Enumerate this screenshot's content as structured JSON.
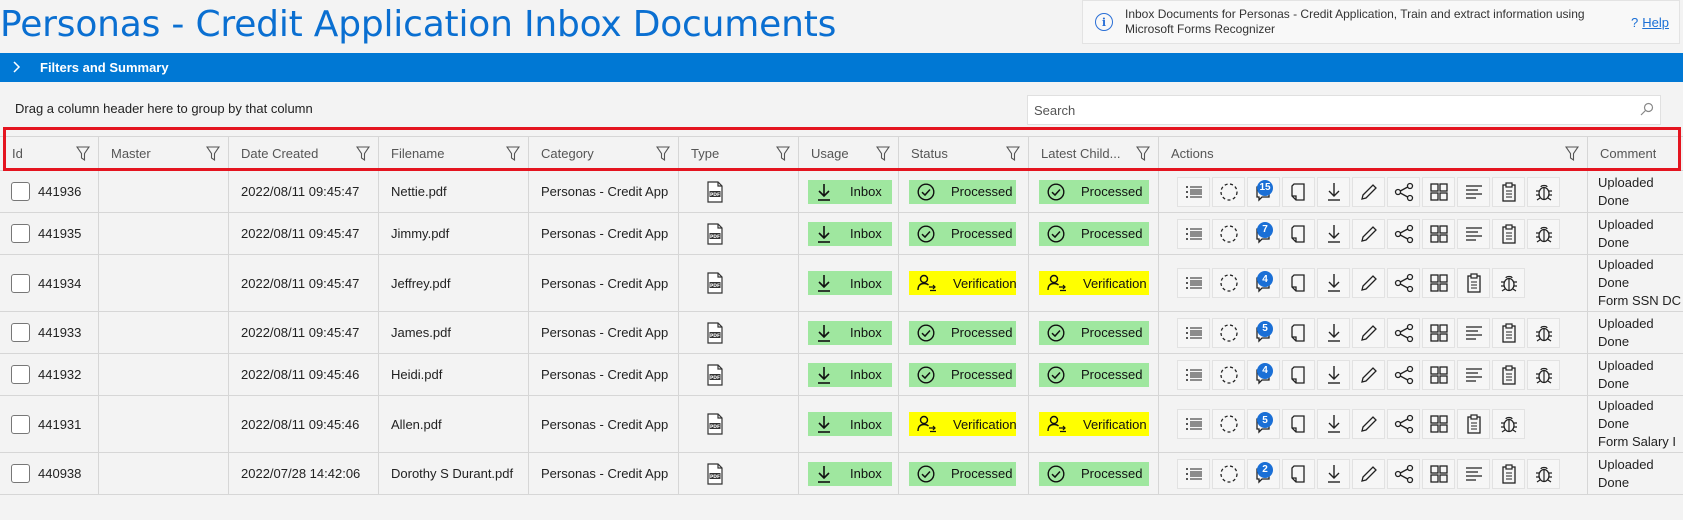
{
  "page": {
    "title": "Personas - Credit Application Inbox Documents",
    "info_text": "Inbox Documents for Personas - Credit Application, Train and extract information using Microsoft Forms Recognizer",
    "help_icon": "?",
    "help_label": "Help",
    "filters_label": "Filters and Summary",
    "group_hint": "Drag a column header here to group by that column",
    "search_placeholder": "Search"
  },
  "columns": [
    {
      "label": "Id"
    },
    {
      "label": "Master"
    },
    {
      "label": "Date Created"
    },
    {
      "label": "Filename"
    },
    {
      "label": "Category"
    },
    {
      "label": "Type"
    },
    {
      "label": "Usage"
    },
    {
      "label": "Status"
    },
    {
      "label": "Latest Child..."
    },
    {
      "label": "Actions"
    },
    {
      "label": "Comment"
    }
  ],
  "rows": [
    {
      "id": "441936",
      "master": "",
      "date": "2022/08/11 09:45:47",
      "filename": "Nettie.pdf",
      "category": "Personas - Credit App",
      "usage": "Inbox",
      "status": "Processed",
      "child": "Processed",
      "badge": "15",
      "comment": [
        "Uploaded",
        "Done"
      ]
    },
    {
      "id": "441935",
      "master": "",
      "date": "2022/08/11 09:45:47",
      "filename": "Jimmy.pdf",
      "category": "Personas - Credit App",
      "usage": "Inbox",
      "status": "Processed",
      "child": "Processed",
      "badge": "7",
      "comment": [
        "Uploaded",
        "Done"
      ]
    },
    {
      "id": "441934",
      "master": "",
      "date": "2022/08/11 09:45:47",
      "filename": "Jeffrey.pdf",
      "category": "Personas - Credit App",
      "usage": "Inbox",
      "status": "Verification",
      "child": "Verification",
      "badge": "4",
      "comment": [
        "Uploaded",
        "Done",
        "Form SSN DC"
      ]
    },
    {
      "id": "441933",
      "master": "",
      "date": "2022/08/11 09:45:47",
      "filename": "James.pdf",
      "category": "Personas - Credit App",
      "usage": "Inbox",
      "status": "Processed",
      "child": "Processed",
      "badge": "5",
      "comment": [
        "Uploaded",
        "Done"
      ]
    },
    {
      "id": "441932",
      "master": "",
      "date": "2022/08/11 09:45:46",
      "filename": "Heidi.pdf",
      "category": "Personas - Credit App",
      "usage": "Inbox",
      "status": "Processed",
      "child": "Processed",
      "badge": "4",
      "comment": [
        "Uploaded",
        "Done"
      ]
    },
    {
      "id": "441931",
      "master": "",
      "date": "2022/08/11 09:45:46",
      "filename": "Allen.pdf",
      "category": "Personas - Credit App",
      "usage": "Inbox",
      "status": "Verification",
      "child": "Verification",
      "badge": "5",
      "comment": [
        "Uploaded",
        "Done",
        "Form Salary I"
      ]
    },
    {
      "id": "440938",
      "master": "",
      "date": "2022/07/28 14:42:06",
      "filename": "Dorothy S Durant.pdf",
      "category": "Personas - Credit App",
      "usage": "Inbox",
      "status": "Processed",
      "child": "Processed",
      "badge": "2",
      "comment": [
        "Uploaded",
        "Done"
      ]
    }
  ],
  "colors": {
    "accent": "#0078d4",
    "title": "#0a6fd1",
    "processed": "#9fe79f",
    "verification": "#ffff00",
    "highlight": "#e4141f",
    "badge": "#1a6fd6"
  },
  "icons": {
    "info": "info-icon",
    "filters_chevron": "chevron-right-icon",
    "search": "search-icon",
    "column_filter": "funnel-icon",
    "type": "pdf-file-icon",
    "usage": "download-arrow-icon",
    "processed": "check-circle-icon",
    "verification": "user-transfer-icon",
    "actions": [
      "list-icon",
      "dashed-circle-icon",
      "comments-icon",
      "document-corner-icon",
      "download-icon",
      "edit-pencil-icon",
      "share-icon",
      "grid-icon",
      "text-align-icon",
      "clipboard-icon",
      "bug-icon"
    ]
  }
}
